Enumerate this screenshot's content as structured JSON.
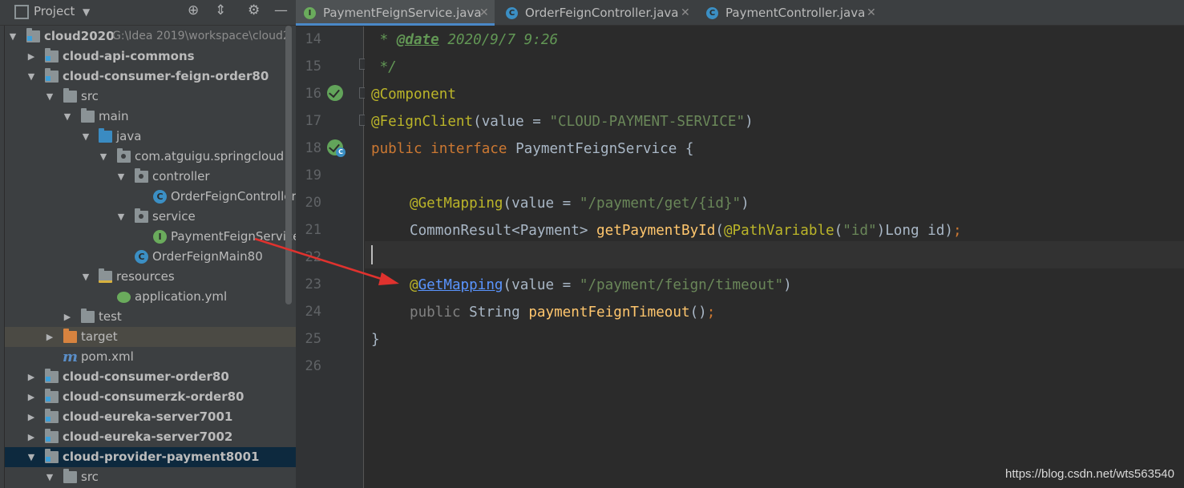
{
  "project_panel": {
    "title": "Project",
    "tree": [
      {
        "label": "cloud2020",
        "path": "G:\\Idea 2019\\workspace\\cloud2"
      },
      {
        "label": "cloud-api-commons"
      },
      {
        "label": "cloud-consumer-feign-order80"
      },
      {
        "label": "src"
      },
      {
        "label": "main"
      },
      {
        "label": "java"
      },
      {
        "label": "com.atguigu.springcloud"
      },
      {
        "label": "controller"
      },
      {
        "label": "OrderFeignController"
      },
      {
        "label": "service"
      },
      {
        "label": "PaymentFeignService"
      },
      {
        "label": "OrderFeignMain80"
      },
      {
        "label": "resources"
      },
      {
        "label": "application.yml"
      },
      {
        "label": "test"
      },
      {
        "label": "target"
      },
      {
        "label": "pom.xml"
      },
      {
        "label": "cloud-consumer-order80"
      },
      {
        "label": "cloud-consumerzk-order80"
      },
      {
        "label": "cloud-eureka-server7001"
      },
      {
        "label": "cloud-eureka-server7002"
      },
      {
        "label": "cloud-provider-payment8001"
      },
      {
        "label": "src"
      }
    ]
  },
  "tabs": [
    {
      "label": "PaymentFeignService.java",
      "icon": "I"
    },
    {
      "label": "OrderFeignController.java",
      "icon": "C"
    },
    {
      "label": "PaymentController.java",
      "icon": "C"
    }
  ],
  "editor": {
    "line_numbers": [
      "14",
      "15",
      "16",
      "17",
      "18",
      "19",
      "20",
      "21",
      "22",
      "23",
      "24",
      "25",
      "26"
    ],
    "code": {
      "l14_star": " * ",
      "l14_tag": "@date",
      "l14_rest": " 2020/9/7 9:26",
      "l15": " */",
      "l16": "@Component",
      "l17_ann": "@FeignClient",
      "l17_open": "(value = ",
      "l17_str": "\"CLOUD-PAYMENT-SERVICE\"",
      "l17_close": ")",
      "l18_kw": "public interface",
      "l18_rest": " PaymentFeignService {",
      "l20_ann": "@GetMapping",
      "l20_open": "(value = ",
      "l20_str": "\"/payment/get/{id}\"",
      "l20_close": ")",
      "l21_type": "CommonResult<Payment> ",
      "l21_fn": "getPaymentById",
      "l21_paren": "(",
      "l21_ann": "@PathVariable",
      "l21_open2": "(",
      "l21_str": "\"id\"",
      "l21_rest": ")Long id)",
      "l21_semi": ";",
      "l23_at": "@",
      "l23_link": "GetMapping",
      "l23_open": "(value = ",
      "l23_str": "\"/payment/feign/timeout\"",
      "l23_close": ")",
      "l24_kw": "public",
      "l24_type": " String ",
      "l24_fn": "paymentFeignTimeout",
      "l24_rest": "()",
      "l24_semi": ";",
      "l25": "}"
    }
  },
  "watermark": "https://blog.csdn.net/wts563540",
  "colors": {
    "keyword": "#cc7832",
    "annotation": "#bbb529",
    "string": "#6a8759",
    "method": "#ffc66d",
    "doc": "#629755",
    "arrow": "#e0322e"
  }
}
